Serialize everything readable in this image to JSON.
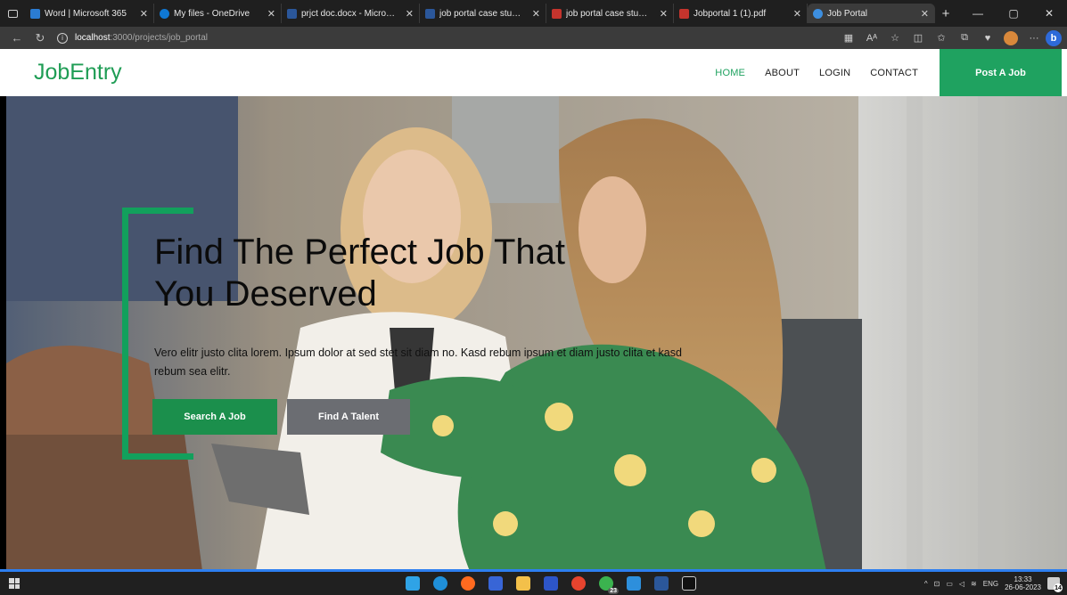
{
  "browser": {
    "tabs": [
      {
        "title": "Word | Microsoft 365",
        "color": "#2b7cd3",
        "active": false
      },
      {
        "title": "My files - OneDrive",
        "color": "#0f78d4",
        "active": false
      },
      {
        "title": "prjct doc.docx - Microsoft",
        "color": "#2b579a",
        "active": false
      },
      {
        "title": "job portal case study print",
        "color": "#2b579a",
        "active": false
      },
      {
        "title": "job portal case study print",
        "color": "#c4342d",
        "active": false
      },
      {
        "title": "Jobportal 1 (1).pdf",
        "color": "#c4342d",
        "active": false
      },
      {
        "title": "Job Portal",
        "color": "#3d8fe0",
        "active": true
      }
    ],
    "url_host": "localhost",
    "url_path": ":3000/projects/job_portal"
  },
  "site": {
    "brand": "JobEntry",
    "nav": [
      "HOME",
      "ABOUT",
      "LOGIN",
      "CONTACT"
    ],
    "post_job": "Post A Job"
  },
  "hero": {
    "title_line1": "Find The Perfect Job That",
    "title_line2": "You Deserved",
    "text": "Vero elitr justo clita lorem. Ipsum dolor at sed stet sit diam no. Kasd rebum ipsum et diam justo clita et kasd rebum sea elitr.",
    "btn_search": "Search A Job",
    "btn_talent": "Find A Talent"
  },
  "taskbar": {
    "lang": "ENG",
    "time": "13:33",
    "date": "26-06-2023",
    "whatsapp_badge": "23",
    "notif_count": "14"
  },
  "colors": {
    "accent": "#1fa260"
  }
}
